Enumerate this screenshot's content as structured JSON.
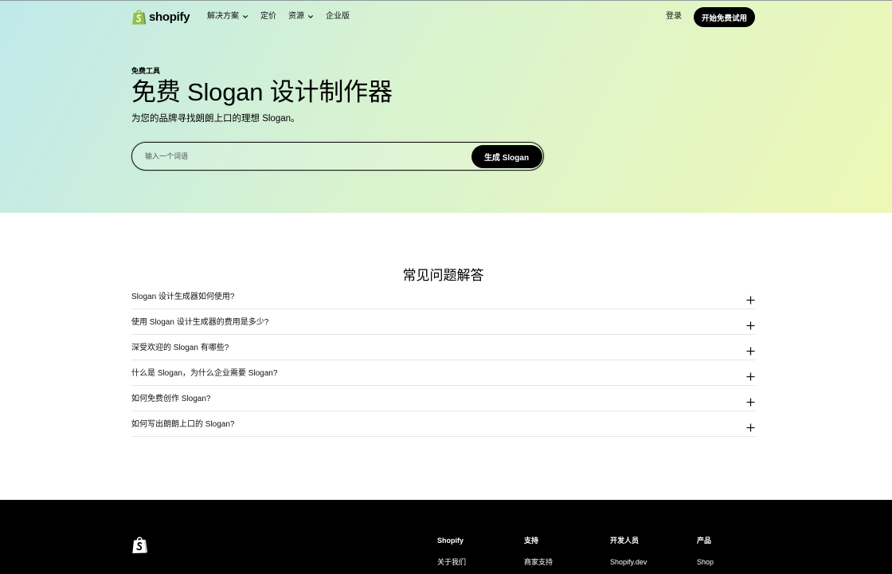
{
  "nav": {
    "logo_text": "shopify",
    "items": [
      {
        "label": "解决方案",
        "has_dropdown": true
      },
      {
        "label": "定价",
        "has_dropdown": false
      },
      {
        "label": "资源",
        "has_dropdown": true
      },
      {
        "label": "企业版",
        "has_dropdown": false
      }
    ],
    "login_label": "登录",
    "cta_label": "开始免费试用"
  },
  "hero": {
    "eyebrow": "免费工具",
    "title": "免费 Slogan 设计制作器",
    "subtitle": "为您的品牌寻找朗朗上口的理想 Slogan。",
    "search": {
      "placeholder": "输入一个词语",
      "button_label": "生成 Slogan"
    }
  },
  "faq": {
    "title": "常见问题解答",
    "items": [
      {
        "question": "Slogan 设计生成器如何使用?",
        "expanded": false
      },
      {
        "question": "使用 Slogan 设计生成器的费用是多少?",
        "expanded": false
      },
      {
        "question": "深受欢迎的 Slogan 有哪些?",
        "expanded": false
      },
      {
        "question": "什么是 Slogan，为什么企业需要 Slogan?",
        "expanded": false
      },
      {
        "question": "如何免费创作 Slogan?",
        "expanded": false
      },
      {
        "question": "如何写出朗朗上口的 Slogan?",
        "expanded": false
      }
    ]
  },
  "footer": {
    "columns": [
      {
        "heading": "Shopify",
        "links": [
          "关于我们"
        ]
      },
      {
        "heading": "支持",
        "links": [
          "商家支持"
        ]
      },
      {
        "heading": "开发人员",
        "links": [
          "Shopify.dev"
        ]
      },
      {
        "heading": "产品",
        "links": [
          "Shop"
        ]
      }
    ]
  },
  "icons": {
    "logo": "shopify-bag-icon",
    "nav_dropdown": "chevron-down-icon",
    "faq_toggle": "plus-icon",
    "footer_logo": "shopify-bag-icon"
  },
  "colors": {
    "brand_green": "#95BF47",
    "brand_green_dark": "#5E8E3E",
    "ink": "#000000",
    "cta_bg": "#000000",
    "footer_bg": "#000000",
    "divider": "#e6e6e6",
    "hero_gradient_start": "#bfe9ea",
    "hero_gradient_mid": "#d9f3cf",
    "hero_gradient_end": "#eef8b6"
  }
}
